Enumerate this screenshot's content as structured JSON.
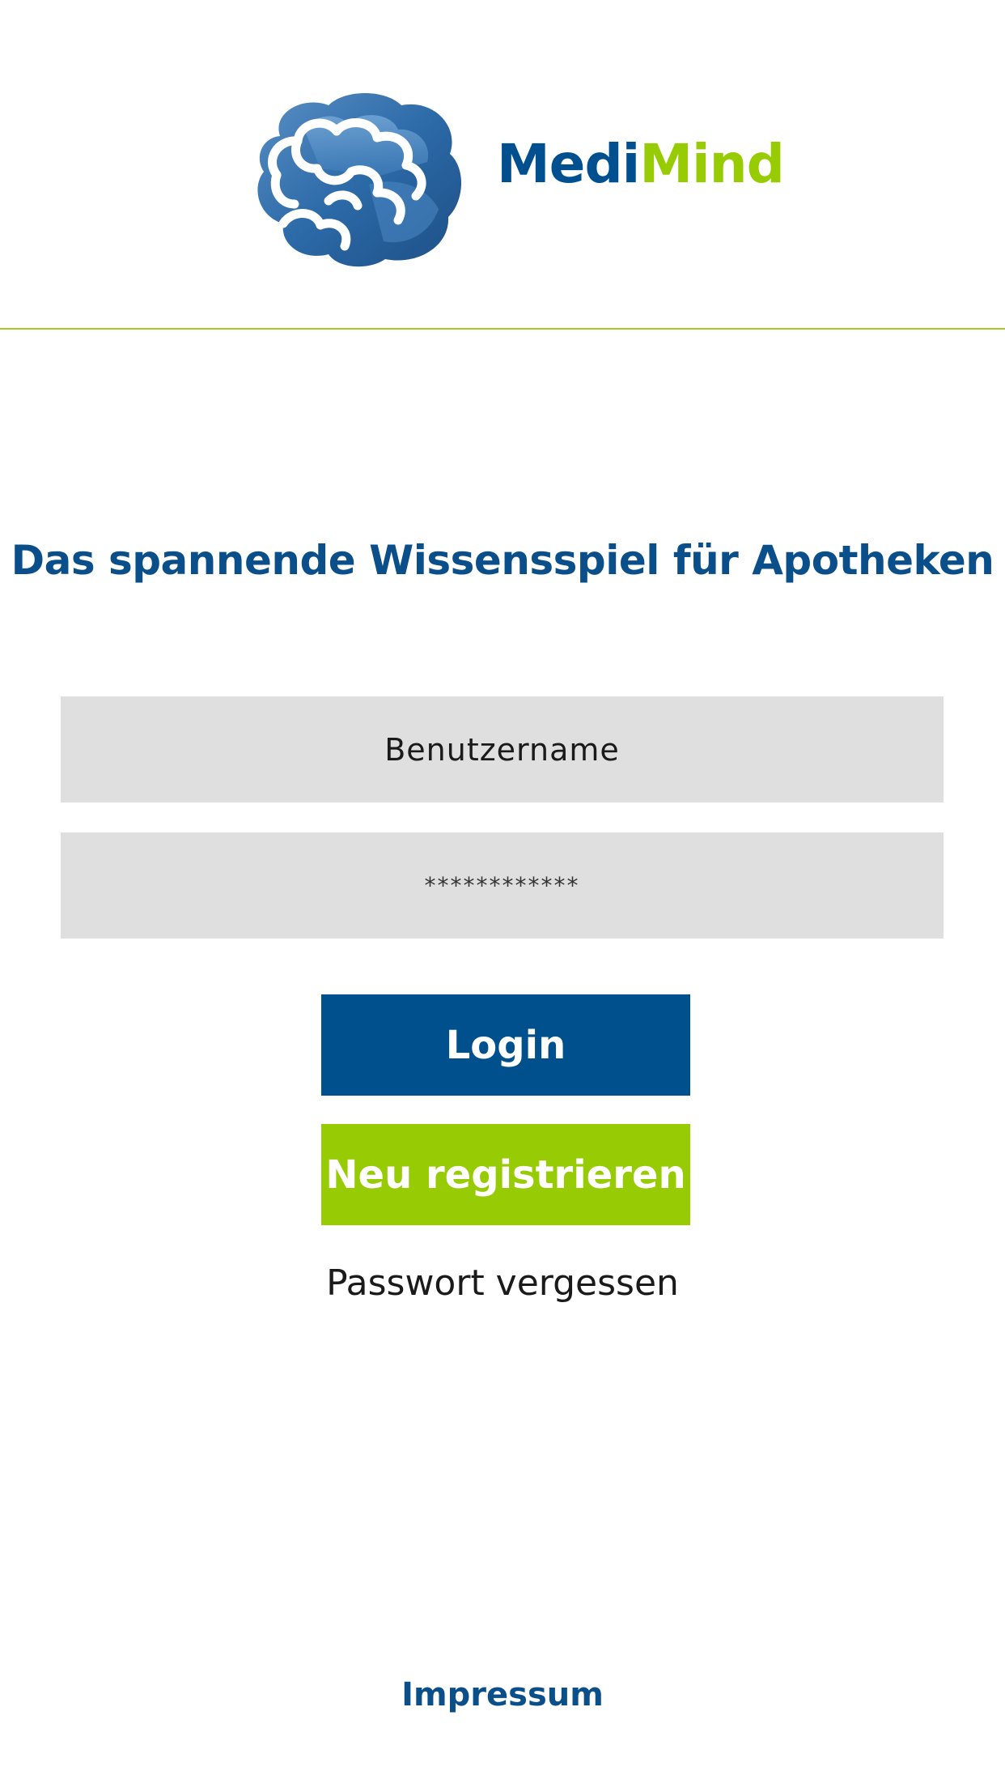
{
  "brand": {
    "name_part1": "Medi",
    "name_part2": "Mind",
    "logo_icon": "brain-icon",
    "colors": {
      "primary_blue": "#00508e",
      "accent_green": "#97cb04",
      "field_gray": "#dfdfdf",
      "divider_green": "#a6c928"
    }
  },
  "tagline": "Das spannende Wissensspiel für Apotheken",
  "form": {
    "username_placeholder": "Benutzername",
    "password_value": "************",
    "login_label": "Login",
    "register_label": "Neu registrieren",
    "forgot_label": "Passwort vergessen"
  },
  "footer": {
    "impressum_label": "Impressum"
  }
}
